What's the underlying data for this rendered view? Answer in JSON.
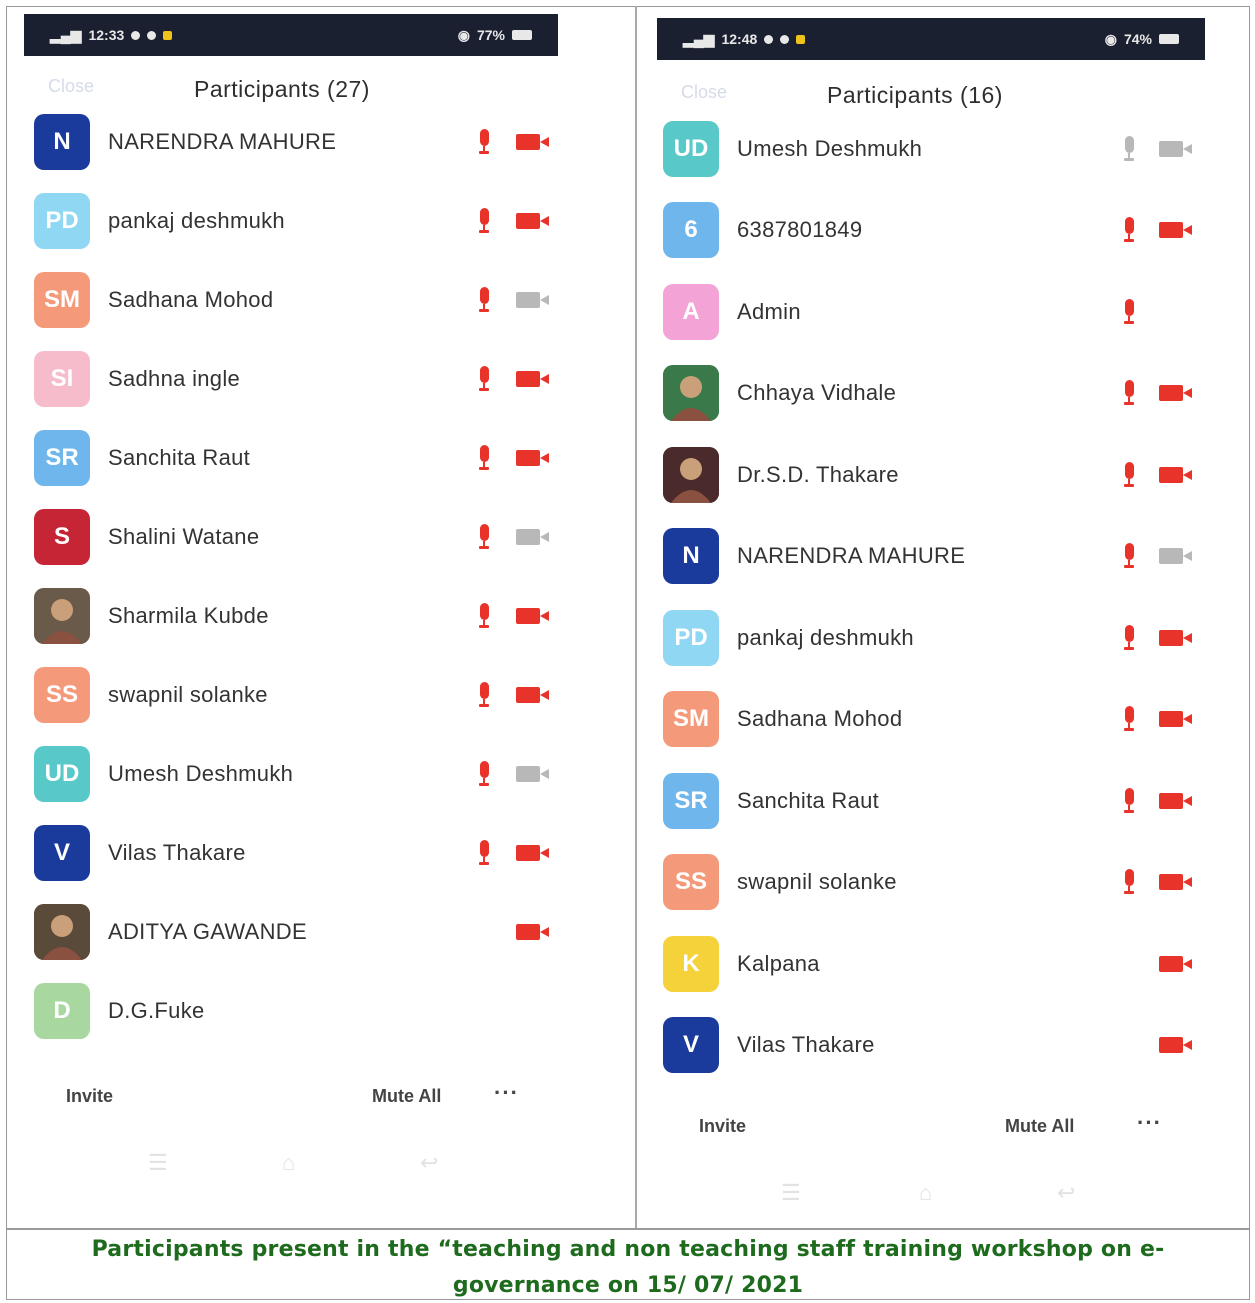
{
  "colors": {
    "accent_red": "#e8332a",
    "muted_gray": "#b8b8b8",
    "status_bar": "#1b2030",
    "caption_green": "#1e6b1e"
  },
  "left_screen": {
    "status": {
      "time": "12:33",
      "battery": "77%"
    },
    "close_label": "Close",
    "title": "Participants (27)",
    "participants": [
      {
        "name": "NARENDRA MAHURE",
        "initials": "N",
        "avatar_color": "#1a3a9c",
        "mic": "on",
        "video": "on"
      },
      {
        "name": "pankaj deshmukh",
        "initials": "PD",
        "avatar_color": "#8fd7f2",
        "mic": "on",
        "video": "on"
      },
      {
        "name": "Sadhana Mohod",
        "initials": "SM",
        "avatar_color": "#f49a7a",
        "mic": "on",
        "video": "off"
      },
      {
        "name": "Sadhna ingle",
        "initials": "SI",
        "avatar_color": "#f7bccb",
        "mic": "on",
        "video": "on"
      },
      {
        "name": "Sanchita Raut",
        "initials": "SR",
        "avatar_color": "#6eb6ec",
        "mic": "on",
        "video": "on"
      },
      {
        "name": "Shalini Watane",
        "initials": "S",
        "avatar_color": "#c62535",
        "mic": "on",
        "video": "off"
      },
      {
        "name": "Sharmila Kubde",
        "initials": "",
        "avatar_color": "#6a5a4a",
        "mic": "on",
        "video": "on",
        "photo": true
      },
      {
        "name": "swapnil solanke",
        "initials": "SS",
        "avatar_color": "#f49a7a",
        "mic": "on",
        "video": "on"
      },
      {
        "name": "Umesh Deshmukh",
        "initials": "UD",
        "avatar_color": "#58c8c8",
        "mic": "on",
        "video": "off"
      },
      {
        "name": "Vilas Thakare",
        "initials": "V",
        "avatar_color": "#1a3a9c",
        "mic": "on",
        "video": "on"
      },
      {
        "name": "ADITYA GAWANDE",
        "initials": "",
        "avatar_color": "#5a4a3a",
        "mic": "none",
        "video": "on",
        "photo": true
      },
      {
        "name": "D.G.Fuke",
        "initials": "D",
        "avatar_color": "#a8d8a0",
        "mic": "none",
        "video": "none"
      }
    ],
    "footer": {
      "invite_label": "Invite",
      "mute_all_label": "Mute All",
      "more_label": "···"
    }
  },
  "right_screen": {
    "status": {
      "time": "12:48",
      "battery": "74%"
    },
    "close_label": "Close",
    "title": "Participants (16)",
    "participants": [
      {
        "name": "Umesh Deshmukh",
        "initials": "UD",
        "avatar_color": "#58c8c8",
        "mic": "off",
        "video": "off"
      },
      {
        "name": "6387801849",
        "initials": "6",
        "avatar_color": "#6eb6ec",
        "mic": "on",
        "video": "on"
      },
      {
        "name": "Admin",
        "initials": "A",
        "avatar_color": "#f3a3d6",
        "mic": "on",
        "video": "none"
      },
      {
        "name": "Chhaya Vidhale",
        "initials": "",
        "avatar_color": "#3a7a4a",
        "mic": "on",
        "video": "on",
        "photo": true
      },
      {
        "name": "Dr.S.D. Thakare",
        "initials": "",
        "avatar_color": "#4a2a2a",
        "mic": "on",
        "video": "on",
        "photo": true
      },
      {
        "name": "NARENDRA MAHURE",
        "initials": "N",
        "avatar_color": "#1a3a9c",
        "mic": "on",
        "video": "off"
      },
      {
        "name": "pankaj deshmukh",
        "initials": "PD",
        "avatar_color": "#8fd7f2",
        "mic": "on",
        "video": "on"
      },
      {
        "name": "Sadhana Mohod",
        "initials": "SM",
        "avatar_color": "#f49a7a",
        "mic": "on",
        "video": "on"
      },
      {
        "name": "Sanchita Raut",
        "initials": "SR",
        "avatar_color": "#6eb6ec",
        "mic": "on",
        "video": "on"
      },
      {
        "name": "swapnil solanke",
        "initials": "SS",
        "avatar_color": "#f49a7a",
        "mic": "on",
        "video": "on"
      },
      {
        "name": "Kalpana",
        "initials": "K",
        "avatar_color": "#f5d23a",
        "mic": "none",
        "video": "on"
      },
      {
        "name": "Vilas Thakare",
        "initials": "V",
        "avatar_color": "#1a3a9c",
        "mic": "none",
        "video": "on"
      }
    ],
    "footer": {
      "invite_label": "Invite",
      "mute_all_label": "Mute All",
      "more_label": "···"
    }
  },
  "caption": {
    "line1": "Participants present  in  the “teaching and non teaching staff training workshop on e-",
    "line2": "governance on 15/ 07/ 2021"
  }
}
